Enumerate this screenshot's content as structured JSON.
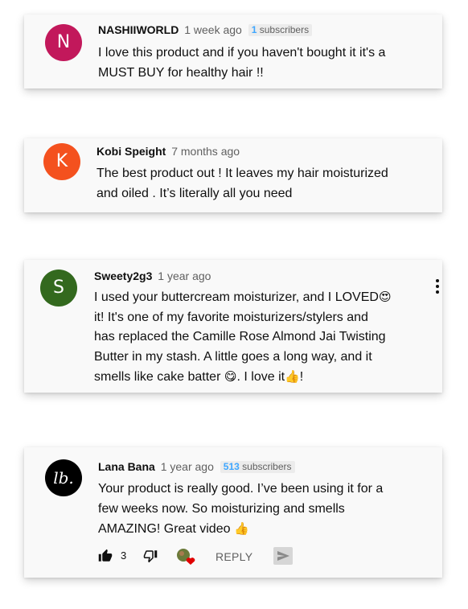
{
  "comments": [
    {
      "author": "NASHIIWORLD",
      "time": "1 week ago",
      "subscribers_count": "1",
      "subscribers_label": "subscribers",
      "avatar_letter": "N",
      "avatar_color": "#c2185b",
      "text": "I love this product and if you haven't bought it it's a\nMUST BUY for healthy hair !!"
    },
    {
      "author": "Kobi Speight",
      "time": "7 months ago",
      "avatar_letter": "K",
      "avatar_color": "#f4511e",
      "text": "The best product out ! It leaves my hair moisturized\nand oiled . It’s literally all you need"
    },
    {
      "author": "Sweety2g3",
      "time": "1 year ago",
      "avatar_letter": "S",
      "avatar_color": "#33691e",
      "text_lines": [
        "I used your buttercream moisturizer, and I LOVED",
        "it! It's one of my favorite moisturizers/stylers and",
        "has replaced the Camille Rose Almond Jai Twisting",
        "Butter in my stash. A little goes a long way, and it",
        "smells like cake batter",
        ". I love it",
        "!"
      ],
      "emojis": {
        "heart_eyes": "😍",
        "yum": "😋",
        "thumbs_up": "👍"
      },
      "menu_icon": "more-vert-icon"
    },
    {
      "author": "Lana Bana",
      "time": "1 year ago",
      "subscribers_count": "513",
      "subscribers_label": "subscribers",
      "avatar_text": "lb.",
      "avatar_color": "#000000",
      "text_lines": [
        "Your product is really good. I’ve been using it for a",
        "few weeks now. So moisturizing and smells",
        "AMAZING! Great video"
      ],
      "emoji": "👍",
      "actions": {
        "like_count": "3",
        "reply_label": "REPLY"
      }
    }
  ],
  "colors": {
    "card_bg": "#f9f9f9",
    "subscriber_accent": "#3ea6ff",
    "heart": "#e00000"
  }
}
